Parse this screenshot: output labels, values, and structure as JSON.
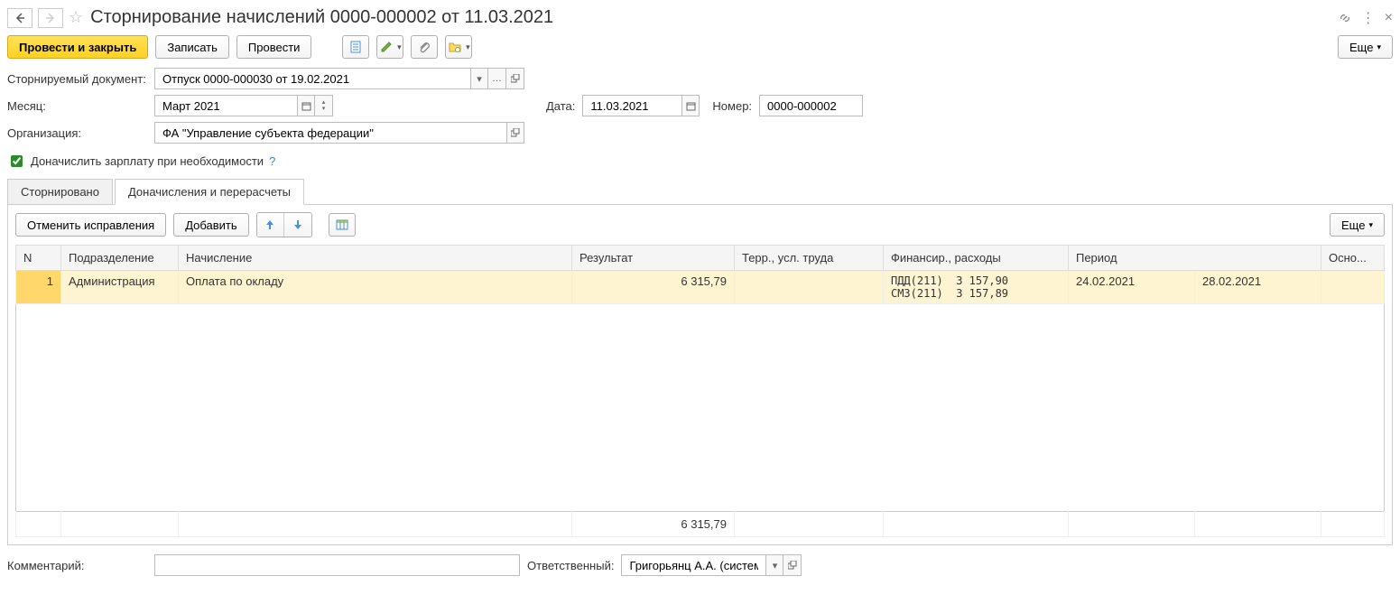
{
  "title": "Сторнирование начислений 0000-000002 от 11.03.2021",
  "toolbar": {
    "post_close": "Провести и закрыть",
    "write": "Записать",
    "post": "Провести",
    "more": "Еще"
  },
  "labels": {
    "storn_doc": "Сторнируемый документ:",
    "month": "Месяц:",
    "date": "Дата:",
    "number": "Номер:",
    "org": "Организация:",
    "recalc_check": "Доначислить зарплату при необходимости",
    "comment": "Комментарий:",
    "responsible": "Ответственный:"
  },
  "values": {
    "storn_doc": "Отпуск 0000-000030 от 19.02.2021",
    "month": "Март 2021",
    "date": "11.03.2021",
    "number": "0000-000002",
    "org": "ФА \"Управление субъекта федерации\"",
    "comment": "",
    "responsible": "Григорьянц А.А. (системн"
  },
  "tabs": {
    "reversed": "Сторнировано",
    "recalcs": "Доначисления и перерасчеты"
  },
  "tab_toolbar": {
    "cancel": "Отменить исправления",
    "add": "Добавить",
    "more": "Еще"
  },
  "columns": {
    "n": "N",
    "dept": "Подразделение",
    "accrual": "Начисление",
    "result": "Результат",
    "terr": "Терр., усл. труда",
    "fin": "Финансир., расходы",
    "period": "Период",
    "basis": "Осно..."
  },
  "rows": [
    {
      "n": "1",
      "dept": "Администрация",
      "accrual": "Оплата по окладу",
      "result": "6 315,79",
      "terr": "",
      "fin": "ПДД(211)  3 157,90\nСМЗ(211)  3 157,89",
      "period_from": "24.02.2021",
      "period_to": "28.02.2021",
      "basis": ""
    }
  ],
  "totals": {
    "result": "6 315,79"
  }
}
